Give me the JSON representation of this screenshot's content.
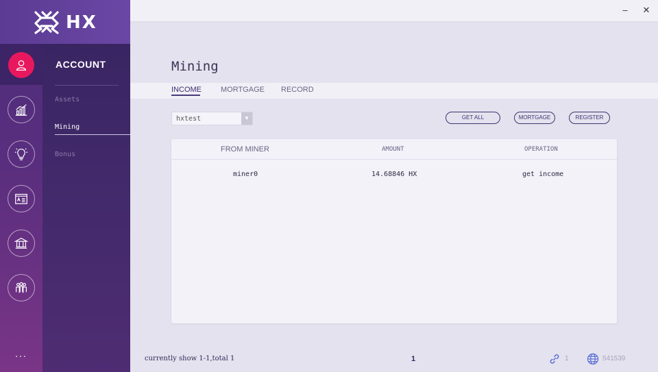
{
  "brand": {
    "name": "HX"
  },
  "window": {
    "minimize": "–",
    "close": "✕"
  },
  "rail": {
    "items": [
      {
        "icon": "user-icon",
        "active": true
      },
      {
        "icon": "chart-icon"
      },
      {
        "icon": "bulb-icon"
      },
      {
        "icon": "id-card-icon"
      },
      {
        "icon": "bank-icon"
      },
      {
        "icon": "people-icon"
      }
    ],
    "more": "..."
  },
  "subnav": {
    "title": "ACCOUNT",
    "items": [
      {
        "label": "Assets"
      },
      {
        "label": "Mining",
        "active": true
      },
      {
        "label": "Bonus"
      }
    ]
  },
  "page": {
    "title": "Mining"
  },
  "tabs": [
    {
      "label": "INCOME",
      "active": true
    },
    {
      "label": "MORTGAGE"
    },
    {
      "label": "RECORD"
    }
  ],
  "account_select": {
    "value": "hxtest"
  },
  "actions": {
    "get_all": "GET ALL",
    "mortgage": "MORTGAGE",
    "register": "REGISTER"
  },
  "table": {
    "headers": {
      "from_miner": "FROM MINER",
      "amount": "AMOUNT",
      "operation": "OPERATION"
    },
    "rows": [
      {
        "from_miner": "miner0",
        "amount": "14.68846 HX",
        "operation": "get income"
      }
    ]
  },
  "footer": {
    "summary": "currently show 1-1,total 1",
    "page": "1",
    "connections": "1",
    "block_height": "541539"
  },
  "colors": {
    "accent": "#e8185e",
    "sidebar": "#3a2563",
    "pill_border": "#3f3370"
  }
}
